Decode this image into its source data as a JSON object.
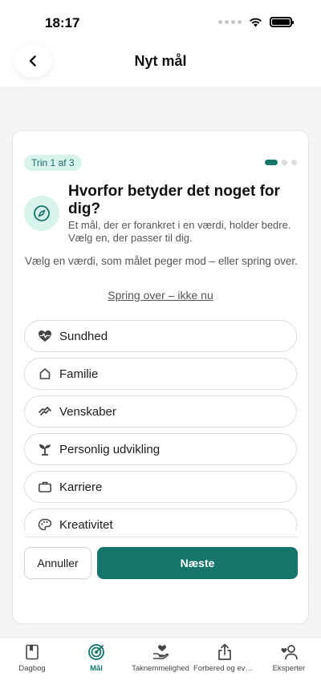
{
  "status_bar": {
    "time": "18:17"
  },
  "header": {
    "title": "Nyt mål",
    "back_icon": "chevron-left-icon"
  },
  "step": {
    "badge": "Trin 1 af 3",
    "current": 1,
    "total": 3
  },
  "question": {
    "icon": "compass-icon",
    "title": "Hvorfor betyder det noget for dig?",
    "subtitle": "Et mål, der er forankret i en værdi, holder bedre. Vælg en, der passer til dig."
  },
  "instruction": "Vælg en værdi, som målet peger mod – eller spring over.",
  "skip_label": "Spring over – ikke nu",
  "values": [
    {
      "label": "Sundhed",
      "icon": "heart-pulse-icon"
    },
    {
      "label": "Familie",
      "icon": "home-icon"
    },
    {
      "label": "Venskaber",
      "icon": "handshake-icon"
    },
    {
      "label": "Personlig udvikling",
      "icon": "sprout-icon"
    },
    {
      "label": "Karriere",
      "icon": "briefcase-icon"
    },
    {
      "label": "Kreativitet",
      "icon": "palette-icon"
    }
  ],
  "actions": {
    "cancel_label": "Annuller",
    "next_label": "Næste"
  },
  "tabs": [
    {
      "label": "Dagbog",
      "icon": "journal-icon",
      "active": false
    },
    {
      "label": "Mål",
      "icon": "target-icon",
      "active": true
    },
    {
      "label": "Taknemmelighed",
      "icon": "gratitude-icon",
      "active": false
    },
    {
      "label": "Forbered og evaluer",
      "icon": "share-icon",
      "active": false
    },
    {
      "label": "Eksperter",
      "icon": "experts-icon",
      "active": false
    }
  ],
  "colors": {
    "accent": "#15756a",
    "accent_light": "#d7f3ec",
    "background": "#f5f5f4"
  }
}
